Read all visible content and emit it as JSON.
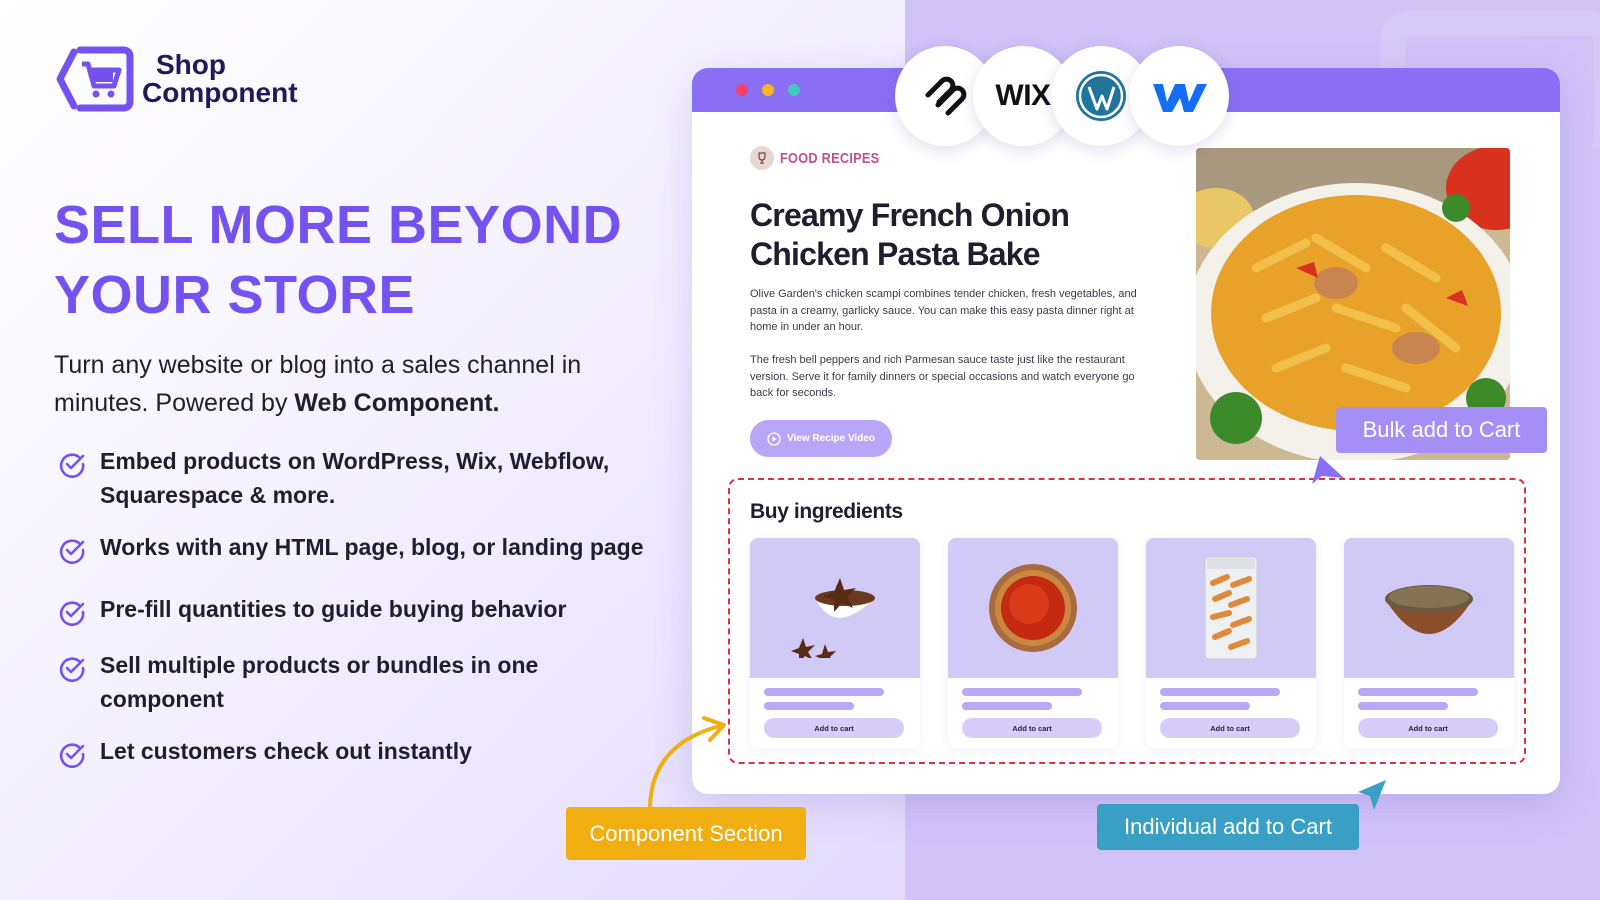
{
  "brand": {
    "name_line1": "Shop",
    "name_line2": "Component",
    "logo_color": "#7552f0"
  },
  "hero": {
    "headline": "SELL MORE BEYOND YOUR STORE",
    "subtitle_prefix": "Turn any website or blog into a sales channel in minutes. Powered by ",
    "subtitle_bold": "Web Component."
  },
  "features": [
    "Embed products on WordPress, Wix, Webflow, Squarespace & more.",
    "Works with any HTML page, blog, or landing page",
    "Pre-fill quantities to guide buying behavior",
    "Sell multiple products or bundles in one component",
    "Let customers check out instantly"
  ],
  "platforms": [
    "squarespace-icon",
    "WIX",
    "wordpress-icon",
    "webflow-icon"
  ],
  "recipe": {
    "category": "FOOD RECIPES",
    "title": "Creamy French Onion Chicken Pasta Bake",
    "paragraph1": "Olive Garden's chicken scampi combines tender chicken, fresh vegetables, and pasta in a creamy, garlicky sauce. You can make this easy pasta dinner right at home in under an hour.",
    "paragraph2": "The fresh bell peppers and rich Parmesan sauce taste just like the restaurant version. Serve it for family dinners or special occasions and watch everyone go back for seconds.",
    "video_button": "View Recipe Video"
  },
  "component": {
    "title": "Buy ingredients",
    "products": [
      {
        "image": "star-anise-icon",
        "button": "Add to cart"
      },
      {
        "image": "paprika-bowl-icon",
        "button": "Add to cart"
      },
      {
        "image": "penne-pack-icon",
        "button": "Add to cart"
      },
      {
        "image": "cumin-bowl-icon",
        "button": "Add to cart"
      }
    ]
  },
  "callouts": {
    "bulk": "Bulk add to Cart",
    "component_section": "Component Section",
    "individual": "Individual add to Cart"
  },
  "colors": {
    "accent": "#7552f0",
    "browser_bar": "#8a6ff4",
    "product_tile": "#d1c9f6",
    "bulk_callout": "#a58ff7",
    "component_callout": "#f0ae10",
    "individual_callout": "#3a9fc5",
    "dashed_border": "#e03040"
  }
}
